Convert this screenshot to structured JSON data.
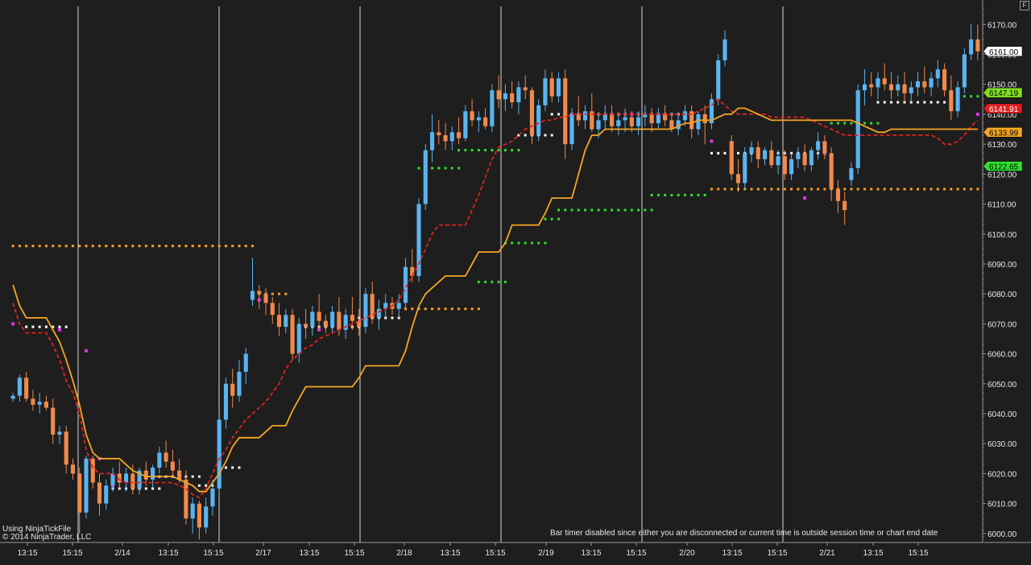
{
  "chart_data": {
    "type": "candlestick",
    "ylim": [
      5997,
      6176
    ],
    "y_ticks": [
      6000,
      6010,
      6020,
      6030,
      6040,
      6050,
      6060,
      6070,
      6080,
      6090,
      6100,
      6110,
      6120,
      6130,
      6140,
      6150,
      6160,
      6170
    ],
    "y_tick_labels": [
      "6000.00",
      "6010.00",
      "6020.00",
      "6030.00",
      "6040.00",
      "6050.00",
      "6060.00",
      "6070.00",
      "6080.00",
      "6090.00",
      "6100.00",
      "6110.00",
      "6120.00",
      "6130.00",
      "6140.00",
      "6150.00",
      "6160.00",
      "6170.00"
    ],
    "x_tick_labels": [
      "13:15",
      "15:15",
      "2/14",
      "13:15",
      "15:15",
      "2/17",
      "13:15",
      "15:15",
      "2/18",
      "13:15",
      "15:15",
      "2/19",
      "13:15",
      "15:15",
      "2/20",
      "13:15",
      "15:15",
      "2/21",
      "13:15",
      "15:15"
    ],
    "grid": false,
    "session_lines": 6,
    "colors": {
      "background": "#1e1e1e",
      "up_candle": "#5ab4f0",
      "down_candle": "#f08a4b",
      "sma_line": "#f5a623",
      "dash_line": "#e02020",
      "level_dots": "#ffa020",
      "green_dots": "#30e030",
      "white_dots": "#ffffff",
      "magenta_dots": "#e030e0",
      "axis_text": "#e8e8e8"
    },
    "price_markers": [
      {
        "value": "6161.00",
        "y": 6161.0,
        "bg": "#ffffff",
        "fg": "#000000"
      },
      {
        "value": "6147.19",
        "y": 6147.19,
        "bg": "#80e020",
        "fg": "#000000"
      },
      {
        "value": "6141.91",
        "y": 6141.91,
        "bg": "#e02020",
        "fg": "#ffffff"
      },
      {
        "value": "6133.99",
        "y": 6133.99,
        "bg": "#f5a623",
        "fg": "#000000"
      },
      {
        "value": "6122.65",
        "y": 6122.65,
        "bg": "#30e030",
        "fg": "#000000"
      }
    ],
    "candles": [
      [
        6045,
        6047,
        6044,
        6046
      ],
      [
        6046,
        6053,
        6044,
        6052
      ],
      [
        6052,
        6054,
        6044,
        6045
      ],
      [
        6045,
        6048,
        6041,
        6043
      ],
      [
        6043,
        6047,
        6040,
        6044
      ],
      [
        6044,
        6046,
        6041,
        6042
      ],
      [
        6042,
        6045,
        6030,
        6033
      ],
      [
        6033,
        6036,
        6030,
        6034
      ],
      [
        6034,
        6036,
        6020,
        6023
      ],
      [
        6023,
        6025,
        6018,
        6020
      ],
      [
        6020,
        6022,
        6000,
        6007
      ],
      [
        6007,
        6026,
        6005,
        6025
      ],
      [
        6025,
        6026,
        6015,
        6017
      ],
      [
        6017,
        6020,
        6006,
        6010
      ],
      [
        6010,
        6018,
        6008,
        6016
      ],
      [
        6016,
        6022,
        6014,
        6020
      ],
      [
        6020,
        6024,
        6015,
        6017
      ],
      [
        6017,
        6022,
        6014,
        6020
      ],
      [
        6020,
        6023,
        6013,
        6015
      ],
      [
        6015,
        6022,
        6013,
        6021
      ],
      [
        6021,
        6024,
        6016,
        6018
      ],
      [
        6018,
        6023,
        6015,
        6022
      ],
      [
        6022,
        6029,
        6020,
        6027
      ],
      [
        6027,
        6031,
        6022,
        6024
      ],
      [
        6024,
        6028,
        6019,
        6021
      ],
      [
        6021,
        6025,
        6017,
        6018
      ],
      [
        6018,
        6021,
        6003,
        6005
      ],
      [
        6005,
        6012,
        6000,
        6010
      ],
      [
        6010,
        6011,
        5998,
        6002
      ],
      [
        6002,
        6012,
        6000,
        6009
      ],
      [
        6009,
        6018,
        6006,
        6015
      ],
      [
        6015,
        6040,
        6013,
        6038
      ],
      [
        6038,
        6052,
        6035,
        6050
      ],
      [
        6050,
        6055,
        6042,
        6046
      ],
      [
        6046,
        6058,
        6044,
        6054
      ],
      [
        6054,
        6062,
        6050,
        6060
      ],
      [
        6078,
        6092,
        6076,
        6081
      ],
      [
        6081,
        6083,
        6075,
        6080
      ],
      [
        6080,
        6082,
        6073,
        6077
      ],
      [
        6077,
        6079,
        6070,
        6073
      ],
      [
        6073,
        6077,
        6066,
        6069
      ],
      [
        6069,
        6075,
        6067,
        6073
      ],
      [
        6073,
        6075,
        6058,
        6060
      ],
      [
        6060,
        6072,
        6057,
        6070
      ],
      [
        6070,
        6075,
        6065,
        6069
      ],
      [
        6069,
        6076,
        6066,
        6074
      ],
      [
        6074,
        6080,
        6068,
        6071
      ],
      [
        6071,
        6073,
        6067,
        6069
      ],
      [
        6069,
        6076,
        6067,
        6074
      ],
      [
        6074,
        6079,
        6066,
        6068
      ],
      [
        6068,
        6075,
        6065,
        6073
      ],
      [
        6073,
        6079,
        6068,
        6071
      ],
      [
        6071,
        6075,
        6066,
        6069
      ],
      [
        6069,
        6082,
        6067,
        6080
      ],
      [
        6080,
        6084,
        6070,
        6072
      ],
      [
        6072,
        6078,
        6068,
        6075
      ],
      [
        6075,
        6080,
        6072,
        6077
      ],
      [
        6077,
        6079,
        6073,
        6075
      ],
      [
        6075,
        6080,
        6072,
        6077
      ],
      [
        6077,
        6092,
        6075,
        6089
      ],
      [
        6089,
        6095,
        6084,
        6086
      ],
      [
        6086,
        6112,
        6084,
        6110
      ],
      [
        6110,
        6130,
        6108,
        6128
      ],
      [
        6128,
        6140,
        6124,
        6134
      ],
      [
        6134,
        6138,
        6130,
        6133
      ],
      [
        6133,
        6137,
        6128,
        6131
      ],
      [
        6131,
        6136,
        6128,
        6134
      ],
      [
        6134,
        6139,
        6130,
        6132
      ],
      [
        6132,
        6143,
        6131,
        6141
      ],
      [
        6141,
        6145,
        6136,
        6138
      ],
      [
        6138,
        6141,
        6134,
        6139
      ],
      [
        6139,
        6142,
        6135,
        6136
      ],
      [
        6136,
        6150,
        6134,
        6148
      ],
      [
        6148,
        6153,
        6142,
        6145
      ],
      [
        6145,
        6150,
        6141,
        6147
      ],
      [
        6147,
        6151,
        6142,
        6144
      ],
      [
        6144,
        6151,
        6140,
        6149
      ],
      [
        6149,
        6153,
        6145,
        6148
      ],
      [
        6148,
        6149,
        6130,
        6133
      ],
      [
        6133,
        6145,
        6131,
        6143
      ],
      [
        6143,
        6155,
        6141,
        6152
      ],
      [
        6152,
        6154,
        6144,
        6146
      ],
      [
        6146,
        6154,
        6144,
        6152
      ],
      [
        6152,
        6155,
        6125,
        6130
      ],
      [
        6130,
        6142,
        6128,
        6140
      ],
      [
        6140,
        6146,
        6136,
        6138
      ],
      [
        6138,
        6143,
        6135,
        6141
      ],
      [
        6141,
        6147,
        6134,
        6135
      ],
      [
        6135,
        6140,
        6132,
        6138
      ],
      [
        6138,
        6143,
        6135,
        6140
      ],
      [
        6140,
        6143,
        6134,
        6136
      ],
      [
        6136,
        6140,
        6133,
        6138
      ],
      [
        6138,
        6142,
        6134,
        6139
      ],
      [
        6139,
        6141,
        6134,
        6136
      ],
      [
        6136,
        6141,
        6133,
        6139
      ],
      [
        6139,
        6143,
        6136,
        6140
      ],
      [
        6140,
        6142,
        6134,
        6137
      ],
      [
        6137,
        6142,
        6135,
        6140
      ],
      [
        6140,
        6143,
        6136,
        6138
      ],
      [
        6138,
        6140,
        6134,
        6135
      ],
      [
        6135,
        6140,
        6133,
        6138
      ],
      [
        6138,
        6143,
        6136,
        6141
      ],
      [
        6141,
        6143,
        6132,
        6135
      ],
      [
        6135,
        6141,
        6133,
        6140
      ],
      [
        6140,
        6143,
        6130,
        6137
      ],
      [
        6137,
        6147,
        6135,
        6145
      ],
      [
        6145,
        6160,
        6143,
        6158
      ],
      [
        6158,
        6168,
        6156,
        6165
      ],
      [
        6131,
        6133,
        6118,
        6120
      ],
      [
        6120,
        6125,
        6114,
        6117
      ],
      [
        6117,
        6129,
        6115,
        6127
      ],
      [
        6127,
        6131,
        6124,
        6129
      ],
      [
        6129,
        6131,
        6122,
        6125
      ],
      [
        6125,
        6129,
        6123,
        6128
      ],
      [
        6128,
        6131,
        6122,
        6123
      ],
      [
        6123,
        6128,
        6120,
        6126
      ],
      [
        6126,
        6128,
        6118,
        6120
      ],
      [
        6120,
        6127,
        6118,
        6125
      ],
      [
        6125,
        6129,
        6122,
        6127
      ],
      [
        6127,
        6130,
        6121,
        6123
      ],
      [
        6123,
        6129,
        6121,
        6128
      ],
      [
        6128,
        6134,
        6125,
        6131
      ],
      [
        6131,
        6133,
        6125,
        6127
      ],
      [
        6127,
        6129,
        6111,
        6115
      ],
      [
        6115,
        6118,
        6107,
        6111
      ],
      [
        6111,
        6114,
        6103,
        6108
      ],
      [
        6118,
        6124,
        6116,
        6122
      ],
      [
        6122,
        6150,
        6120,
        6148
      ],
      [
        6148,
        6155,
        6143,
        6150
      ],
      [
        6150,
        6154,
        6146,
        6149
      ],
      [
        6149,
        6154,
        6145,
        6152
      ],
      [
        6152,
        6157,
        6148,
        6150
      ],
      [
        6150,
        6154,
        6145,
        6148
      ],
      [
        6148,
        6153,
        6146,
        6150
      ],
      [
        6150,
        6154,
        6144,
        6147
      ],
      [
        6147,
        6151,
        6144,
        6149
      ],
      [
        6149,
        6154,
        6146,
        6151
      ],
      [
        6151,
        6156,
        6147,
        6149
      ],
      [
        6149,
        6154,
        6146,
        6152
      ],
      [
        6152,
        6158,
        6149,
        6155
      ],
      [
        6155,
        6157,
        6146,
        6148
      ],
      [
        6148,
        6153,
        6138,
        6141
      ],
      [
        6141,
        6151,
        6139,
        6149
      ],
      [
        6149,
        6162,
        6147,
        6160
      ],
      [
        6160,
        6170,
        6158,
        6165
      ],
      [
        6165,
        6170,
        6158,
        6161
      ]
    ],
    "sma_line": [
      6083,
      6076,
      6072,
      6072,
      6072,
      6072,
      6068,
      6064,
      6058,
      6051,
      6043,
      6033,
      6027,
      6025,
      6025,
      6025,
      6025,
      6023,
      6021,
      6020,
      6019,
      6019,
      6019,
      6019,
      6019,
      6018,
      6017,
      6016,
      6014,
      6014,
      6017,
      6020,
      6024,
      6029,
      6032,
      6032,
      6032,
      6032,
      6034,
      6036,
      6036,
      6036,
      6041,
      6045,
      6049,
      6049,
      6049,
      6049,
      6049,
      6049,
      6049,
      6049,
      6052,
      6056,
      6056,
      6056,
      6056,
      6056,
      6056,
      6061,
      6069,
      6076,
      6080,
      6082,
      6084,
      6086,
      6086,
      6086,
      6086,
      6090,
      6094,
      6094,
      6094,
      6094,
      6097,
      6103,
      6103,
      6103,
      6103,
      6103,
      6107,
      6112,
      6112,
      6112,
      6112,
      6120,
      6128,
      6133,
      6133,
      6135,
      6135,
      6135,
      6135,
      6135,
      6135,
      6135,
      6135,
      6135,
      6135,
      6135,
      6136,
      6137,
      6137,
      6138,
      6138,
      6138,
      6139,
      6140,
      6140,
      6142,
      6142,
      6141,
      6140,
      6139,
      6138,
      6138,
      6138,
      6138,
      6138,
      6138,
      6138,
      6138,
      6138,
      6138,
      6138,
      6138,
      6138,
      6137,
      6136,
      6135,
      6134,
      6134,
      6135,
      6135,
      6135,
      6135,
      6135,
      6135,
      6135,
      6135,
      6135,
      6135,
      6135,
      6135,
      6135,
      6135,
      6135,
      6135,
      6135,
      6134,
      6134,
      6134
    ],
    "dash_line": [
      6077,
      6070,
      6067,
      6067,
      6067,
      6067,
      6063,
      6058,
      6051,
      6047,
      6040,
      6028,
      6022,
      6020,
      6020,
      6020,
      6018,
      6017,
      6017,
      6017,
      6017,
      6017,
      6017,
      6017,
      6017,
      6016,
      6015,
      6013,
      6012,
      6015,
      6020,
      6025,
      6028,
      6032,
      6035,
      6038,
      6040,
      6042,
      6044,
      6047,
      6050,
      6055,
      6058,
      6060,
      6062,
      6063,
      6065,
      6066,
      6067,
      6068,
      6069,
      6070,
      6071,
      6072,
      6073,
      6074,
      6075,
      6076,
      6078,
      6082,
      6086,
      6090,
      6095,
      6100,
      6103,
      6103,
      6103,
      6103,
      6103,
      6108,
      6113,
      6119,
      6125,
      6129,
      6130,
      6131,
      6133,
      6135,
      6136,
      6137,
      6138,
      6138,
      6139,
      6139,
      6140,
      6140,
      6140,
      6140,
      6140,
      6140,
      6140,
      6140,
      6140,
      6140,
      6140,
      6140,
      6140,
      6140,
      6140,
      6140,
      6140,
      6140,
      6140,
      6141,
      6142,
      6143,
      6145,
      6143,
      6141,
      6140,
      6140,
      6140,
      6140,
      6140,
      6139,
      6139,
      6139,
      6139,
      6139,
      6139,
      6138,
      6137,
      6136,
      6135,
      6134,
      6133,
      6133,
      6133,
      6133,
      6133,
      6133,
      6133,
      6133,
      6133,
      6133,
      6133,
      6133,
      6133,
      6133,
      6132,
      6130,
      6130,
      6131,
      6133,
      6136,
      6138,
      6140,
      6142
    ],
    "level_dots": [
      {
        "y": 6096,
        "from": 0,
        "to": 36
      },
      {
        "y": 6080,
        "from": 36,
        "to": 41
      },
      {
        "y": 6075,
        "from": 59,
        "to": 70
      },
      {
        "y": 6115,
        "from": 105,
        "to": 151
      }
    ],
    "white_dots": [
      {
        "y": 6069,
        "from": 2,
        "to": 8
      },
      {
        "y": 6015,
        "from": 14,
        "to": 22
      },
      {
        "y": 6019,
        "from": 22,
        "to": 28
      },
      {
        "y": 6016,
        "from": 28,
        "to": 31
      },
      {
        "y": 6022,
        "from": 32,
        "to": 34
      },
      {
        "y": 6069,
        "from": 43,
        "to": 52
      },
      {
        "y": 6072,
        "from": 52,
        "to": 58
      },
      {
        "y": 6133,
        "from": 76,
        "to": 81
      },
      {
        "y": 6140,
        "from": 81,
        "to": 100
      },
      {
        "y": 6127,
        "from": 105,
        "to": 121
      },
      {
        "y": 6144,
        "from": 130,
        "to": 141
      }
    ],
    "green_dots": [
      {
        "y": 6084,
        "from": 70,
        "to": 74
      },
      {
        "y": 6097,
        "from": 74,
        "to": 80
      },
      {
        "y": 6105,
        "from": 80,
        "to": 82
      },
      {
        "y": 6108,
        "from": 82,
        "to": 96
      },
      {
        "y": 6113,
        "from": 96,
        "to": 104
      },
      {
        "y": 6122,
        "from": 61,
        "to": 67
      },
      {
        "y": 6128,
        "from": 67,
        "to": 76
      },
      {
        "y": 6137,
        "from": 123,
        "to": 130
      },
      {
        "y": 6146,
        "from": 141,
        "to": 151
      }
    ],
    "magenta_dots": [
      {
        "y": 6070,
        "i": 0
      },
      {
        "y": 6068,
        "i": 7
      },
      {
        "y": 6061,
        "i": 11
      },
      {
        "y": 6025,
        "i": 13
      },
      {
        "y": 6016,
        "i": 15
      },
      {
        "y": 6080,
        "i": 36
      },
      {
        "y": 6078,
        "i": 37
      },
      {
        "y": 6068,
        "i": 46
      },
      {
        "y": 6140,
        "i": 93
      },
      {
        "y": 6131,
        "i": 105
      },
      {
        "y": 6125,
        "i": 115
      },
      {
        "y": 6112,
        "i": 119
      },
      {
        "y": 6127,
        "i": 122
      },
      {
        "y": 6140,
        "i": 145
      }
    ]
  },
  "watermark": {
    "line1": "Using NinjaTickFile",
    "line2": "© 2014 NinjaTrader, LLC"
  },
  "status_message": "Bar timer disabled since either you are disconnected or current time is outside session time or chart end date",
  "corner_button_label": "F"
}
